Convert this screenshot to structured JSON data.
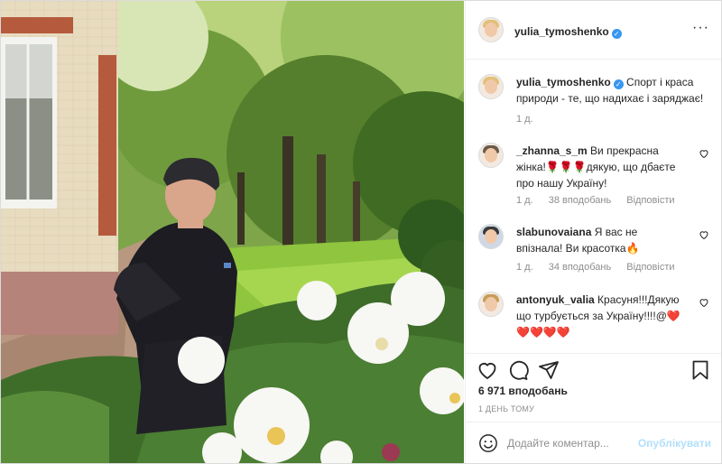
{
  "post": {
    "author": "yulia_tymoshenko",
    "photo_alt": "Woman in black sportswear standing by white peony bushes in a garden",
    "caption": "Спорт і краса природи - те, що надихає і заряджає!",
    "caption_age": "1 д."
  },
  "comments": [
    {
      "user": "_zhanna_s_m",
      "text": "Ви прекрасна жінка!🌹🌹🌹дякую, що дбаєте про нашу Україну!",
      "age": "1 д.",
      "likes": "38 вподобань",
      "reply": "Відповісти"
    },
    {
      "user": "slabunovaiana",
      "text": "Я вас не впізнала! Ви красотка🔥",
      "age": "1 д.",
      "likes": "34 вподобань",
      "reply": "Відповісти"
    },
    {
      "user": "antonyuk_valia",
      "text": "Красуня!!!Дякую що турбується за Україну!!!!@❤️❤️❤️❤️❤️"
    }
  ],
  "actions": {
    "likes": "6 971 вподобань",
    "time": "1 ДЕНЬ ТОМУ"
  },
  "add_comment": {
    "placeholder": "Додайте коментар...",
    "post_label": "Опублікувати"
  },
  "colors": {
    "verified": "#3897f0",
    "post_button_disabled": "#b2dffc",
    "heart_red": "#e0245e"
  }
}
